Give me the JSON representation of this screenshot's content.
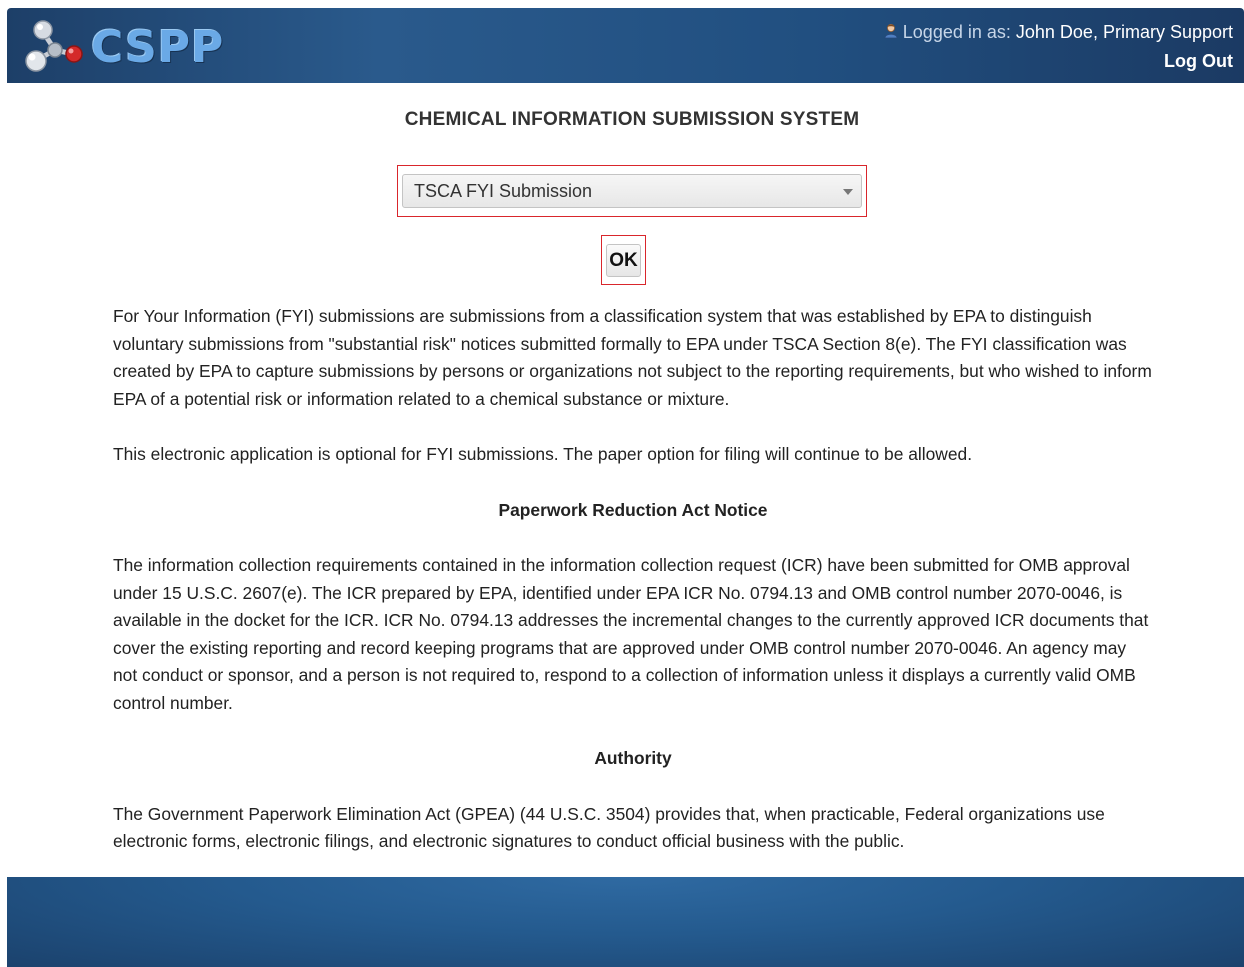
{
  "header": {
    "logo_text": "CSPP",
    "logged_in_label": "Logged in as:",
    "user_name": "John Doe, Primary Support",
    "logout_label": "Log Out"
  },
  "main": {
    "title": "CHEMICAL INFORMATION SUBMISSION SYSTEM",
    "submission_select": {
      "selected": "TSCA FYI Submission"
    },
    "ok_label": "OK",
    "paragraphs": {
      "fyi_description": "For Your Information (FYI) submissions are submissions from a classification system that was established by EPA to distinguish voluntary submissions from \"substantial risk\" notices submitted formally to EPA under TSCA Section 8(e). The FYI classification was created by EPA to capture submissions by persons or organizations not subject to the reporting requirements, but who wished to inform EPA of a potential risk or information related to a chemical substance or mixture.",
      "optional_note": "This electronic application is optional for FYI submissions. The paper option for filing will continue to be allowed.",
      "pra_heading": "Paperwork Reduction Act Notice",
      "pra_text": "The information collection requirements contained in the information collection request (ICR) have been submitted for OMB approval under 15 U.S.C. 2607(e). The ICR prepared by EPA, identified under EPA ICR No. 0794.13 and OMB control number 2070-0046, is available in the docket for the ICR. ICR No. 0794.13 addresses the incremental changes to the currently approved ICR documents that cover the existing reporting and record keeping programs that are approved under OMB control number 2070-0046. An agency may not conduct or sponsor, and a person is not required to, respond to a collection of information unless it displays a currently valid OMB control number.",
      "authority_heading": "Authority",
      "authority_text": "The Government Paperwork Elimination Act (GPEA) (44 U.S.C. 3504) provides that, when practicable, Federal organizations use electronic forms, electronic filings, and electronic signatures to conduct official business with the public."
    }
  },
  "colors": {
    "header_blue": "#2a5a8c",
    "highlight_red": "#d9262c",
    "footer_blue": "#245a8e"
  },
  "icons": {
    "logo": "molecule-logo-icon",
    "user": "user-icon",
    "dropdown": "chevron-down-icon"
  }
}
